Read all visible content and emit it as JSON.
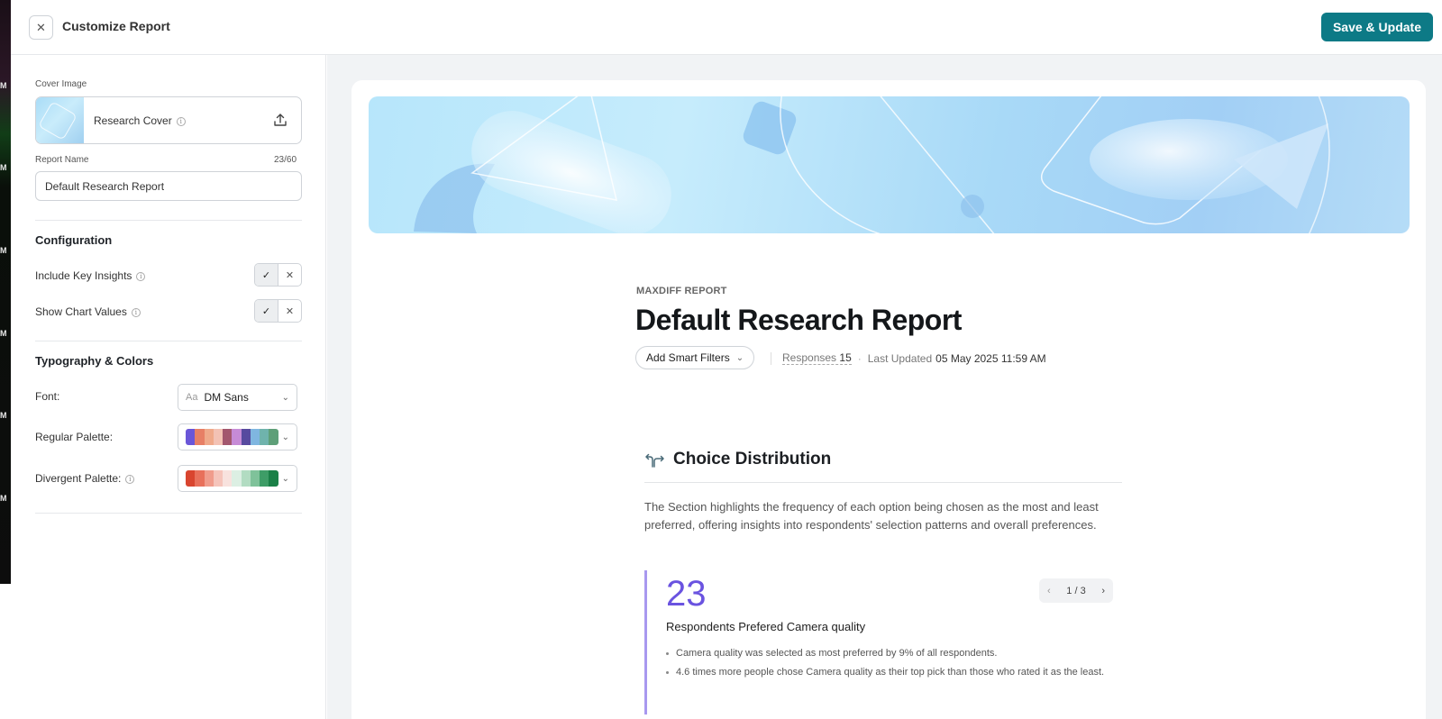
{
  "left_strip": {
    "letters": [
      "M",
      "M",
      "M",
      "M",
      "M",
      "M"
    ]
  },
  "topbar": {
    "close_glyph": "✕",
    "title": "Customize Report",
    "save_label": "Save & Update",
    "accent": "#0d7a86"
  },
  "sidebar": {
    "cover": {
      "label": "Cover Image",
      "name": "Research Cover"
    },
    "report_name": {
      "label": "Report Name",
      "counter": "23/60",
      "value": "Default Research Report"
    },
    "configuration": {
      "title": "Configuration",
      "rows": [
        {
          "label": "Include Key Insights",
          "on": "✓",
          "off": "✕"
        },
        {
          "label": "Show Chart Values",
          "on": "✓",
          "off": "✕"
        }
      ]
    },
    "typography": {
      "title": "Typography & Colors",
      "font": {
        "label": "Font:",
        "prefix": "Aa",
        "value": "DM Sans"
      },
      "regular_palette": {
        "label": "Regular Palette:",
        "colors": [
          "#6a56d8",
          "#e77f65",
          "#efa98a",
          "#f3c2b4",
          "#a3576e",
          "#c68bd6",
          "#574a9f",
          "#7fb6e0",
          "#6fb3ac",
          "#5e9f78"
        ]
      },
      "divergent_palette": {
        "label": "Divergent Palette:",
        "colors": [
          "#d9452f",
          "#e8705b",
          "#f09c8c",
          "#f5c4bb",
          "#f8e2de",
          "#dcefe3",
          "#b2dcc2",
          "#7fc29a",
          "#3e9d67",
          "#1a8047"
        ]
      }
    }
  },
  "report": {
    "eyebrow": "MAXDIFF REPORT",
    "title": "Default Research Report",
    "filters_label": "Add Smart Filters",
    "responses_label": "Responses",
    "responses_count": "15",
    "updated_label": "Last Updated",
    "updated_value": "05 May 2025 11:59 AM",
    "section": {
      "title": "Choice Distribution",
      "description": "The Section highlights the frequency of each option being chosen as the most and least preferred, offering insights into respondents' selection patterns and overall preferences.",
      "insight": {
        "number": "23",
        "pager": "1 / 3",
        "title": "Respondents Prefered Camera quality",
        "bullets": [
          "Camera quality was selected as most preferred by 9% of all respondents.",
          "4.6 times more people chose Camera quality as their top pick than those who rated it as the least."
        ],
        "accent": "#6a53e0"
      }
    }
  }
}
